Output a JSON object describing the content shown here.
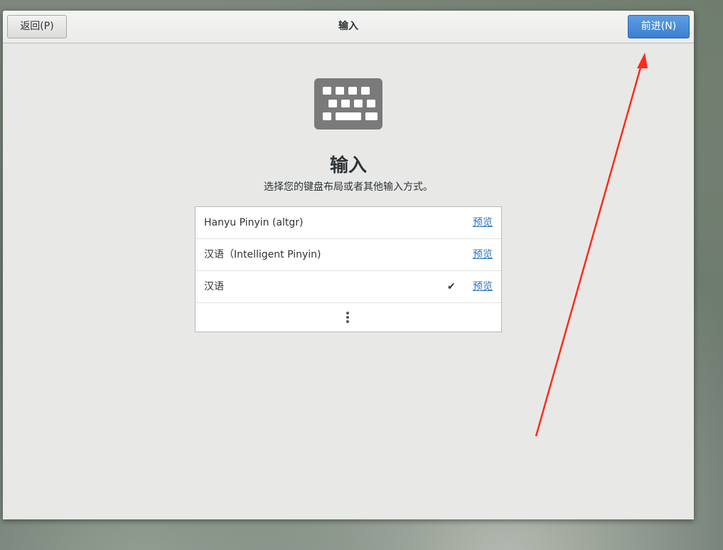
{
  "header": {
    "back_label": "返回(P)",
    "title": "输入",
    "next_label": "前进(N)"
  },
  "page": {
    "title": "输入",
    "subtitle": "选择您的键盘布局或者其他输入方式。"
  },
  "input_sources": [
    {
      "label": "Hanyu Pinyin (altgr)",
      "preview": "预览",
      "selected": false
    },
    {
      "label": "汉语（Intelligent Pinyin)",
      "preview": "预览",
      "selected": false
    },
    {
      "label": "汉语",
      "preview": "预览",
      "selected": true,
      "check": "✔"
    }
  ],
  "icons": {
    "keyboard": "keyboard-icon",
    "more": "more-options-icon",
    "check": "checkmark-icon"
  },
  "colors": {
    "accent": "#3a80d2",
    "link": "#2a76c6",
    "annotation_arrow": "#ff2a1a"
  }
}
